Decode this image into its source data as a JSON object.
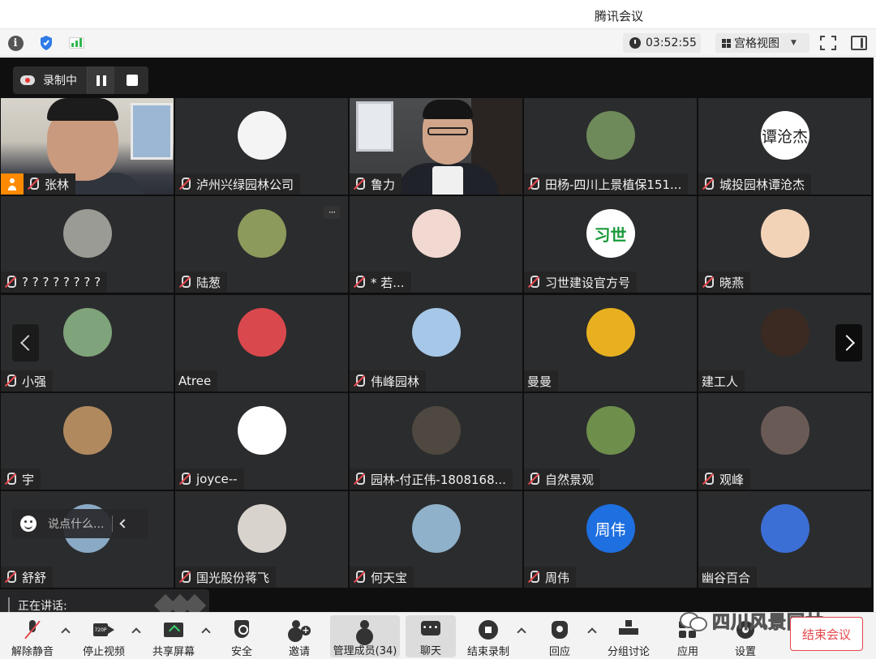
{
  "window": {
    "title": "腾讯会议"
  },
  "toolbar": {
    "timer": "03:52:55",
    "view_mode": "宫格视图"
  },
  "recording": {
    "label": "录制中"
  },
  "participants": [
    {
      "name": "张林",
      "type": "video",
      "host": true,
      "muted": true
    },
    {
      "name": "泸州兴绿园林公司",
      "type": "avatar",
      "muted": true,
      "avatar_color": "#f4f4f4"
    },
    {
      "name": "鲁力",
      "type": "video",
      "muted": true
    },
    {
      "name": "田杨-四川上景植保151...",
      "type": "avatar",
      "muted": true,
      "avatar_color": "#6f8a5a"
    },
    {
      "name": "城投园林谭沧杰",
      "type": "avatar",
      "muted": true,
      "avatar_color": "#ffffff",
      "avatar_text": "谭沧杰"
    },
    {
      "name": "? ? ? ? ? ? ? ?",
      "type": "avatar",
      "muted": true,
      "avatar_color": "#9a9b94"
    },
    {
      "name": "陆葱",
      "type": "avatar",
      "muted": true,
      "avatar_color": "#8c9a5c",
      "more": true
    },
    {
      "name": "* 若...",
      "type": "avatar",
      "muted": true,
      "avatar_color": "#f1d8d0"
    },
    {
      "name": "习世建设官方号",
      "type": "avatar",
      "muted": true,
      "avatar_color": "#ffffff",
      "avatar_text": "习世"
    },
    {
      "name": "晓燕",
      "type": "avatar",
      "muted": true,
      "avatar_color": "#f3d3b8"
    },
    {
      "name": "小强",
      "type": "avatar",
      "muted": true,
      "avatar_color": "#7fa37a"
    },
    {
      "name": "Atree",
      "type": "avatar",
      "muted": false,
      "avatar_color": "#d9484c"
    },
    {
      "name": "伟峰园林",
      "type": "avatar",
      "muted": true,
      "avatar_color": "#a6c7e8"
    },
    {
      "name": "曼曼",
      "type": "avatar",
      "muted": false,
      "avatar_color": "#e8b020"
    },
    {
      "name": "建工人",
      "type": "avatar",
      "muted": false,
      "avatar_color": "#3a2a22"
    },
    {
      "name": "宇",
      "type": "avatar",
      "muted": true,
      "avatar_color": "#b08a5e"
    },
    {
      "name": "joyce--",
      "type": "avatar",
      "muted": true,
      "avatar_color": "#ffffff"
    },
    {
      "name": "园林-付正伟-1808168...",
      "type": "avatar",
      "muted": true,
      "avatar_color": "#4f4840"
    },
    {
      "name": "自然景观",
      "type": "avatar",
      "muted": true,
      "avatar_color": "#6e8f4c"
    },
    {
      "name": "观峰",
      "type": "avatar",
      "muted": true,
      "avatar_color": "#6a5a56"
    },
    {
      "name": "舒舒",
      "type": "avatar",
      "muted": true,
      "avatar_color": "#8aa9c4"
    },
    {
      "name": "国光股份蒋飞",
      "type": "avatar",
      "muted": true,
      "avatar_color": "#d8d3cc"
    },
    {
      "name": "何天宝",
      "type": "avatar",
      "muted": true,
      "avatar_color": "#8fb1c9"
    },
    {
      "name": "周伟",
      "type": "avatar",
      "muted": true,
      "avatar_color": "#1e6fe0",
      "avatar_text": "周伟"
    },
    {
      "name": "幽谷百合",
      "type": "avatar",
      "muted": false,
      "avatar_color": "#3b6fd6"
    }
  ],
  "chat": {
    "placeholder": "说点什么..."
  },
  "speaking": {
    "label": "正在讲话:"
  },
  "bottombar": {
    "items": [
      {
        "label": "解除静音",
        "icon": "mic-off-icon"
      },
      {
        "label": "停止视频",
        "icon": "video-icon"
      },
      {
        "label": "共享屏幕",
        "icon": "share-screen-icon"
      },
      {
        "label": "安全",
        "icon": "shield-icon"
      },
      {
        "label": "邀请",
        "icon": "invite-icon"
      },
      {
        "label": "管理成员(34)",
        "icon": "members-icon"
      },
      {
        "label": "聊天",
        "icon": "chat-icon"
      },
      {
        "label": "结束录制",
        "icon": "stop-record-icon"
      },
      {
        "label": "回应",
        "icon": "reaction-icon"
      },
      {
        "label": "分组讨论",
        "icon": "breakout-icon"
      },
      {
        "label": "应用",
        "icon": "apps-icon"
      },
      {
        "label": "设置",
        "icon": "settings-icon"
      }
    ],
    "end_meeting": "结束会议"
  },
  "watermark": {
    "text": "四川风景园林"
  }
}
